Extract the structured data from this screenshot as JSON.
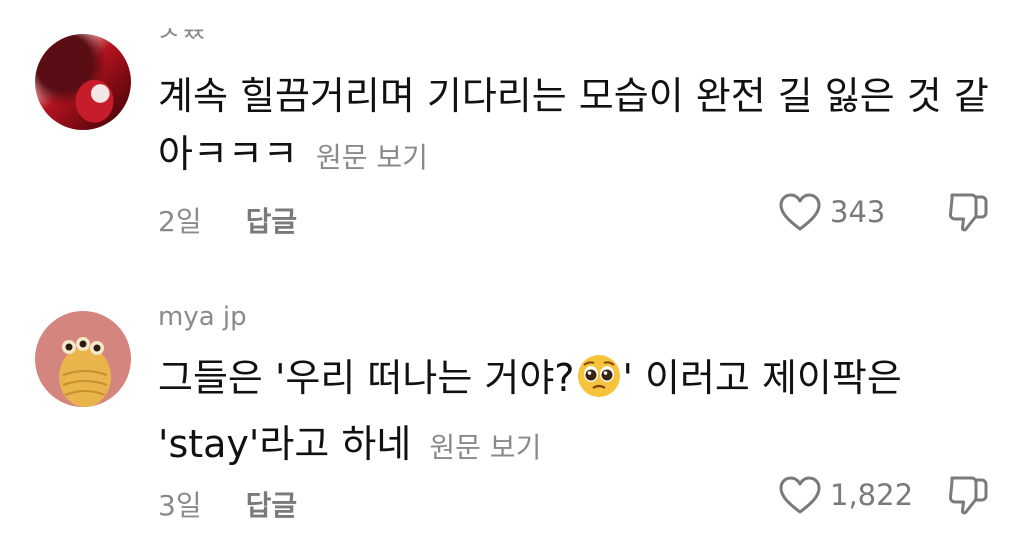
{
  "comments": [
    {
      "username": "ᄼᅑ",
      "text": "계속 힐끔거리며 기다리는 모습이 완전 길 잃은 것 같아ㅋㅋㅋ",
      "see_original": "원문 보기",
      "time": "2일",
      "reply_label": "답글",
      "likes": "343"
    },
    {
      "username": "mya jp",
      "text_before_emoji": "그들은 '우리 떠나는 거야?",
      "emoji": "pleading-face",
      "text_after_emoji": "' 이러고 제이팍은 'stay'라고 하네",
      "see_original": "원문 보기",
      "time": "3일",
      "reply_label": "답글",
      "likes": "1,822"
    }
  ],
  "colors": {
    "muted_text": "#8a8a8a",
    "body_text": "#111111",
    "background": "#ffffff",
    "avatar2_bg": "#d4857e"
  },
  "icons": [
    "heart-outline-icon",
    "thumbs-down-outline-icon"
  ]
}
